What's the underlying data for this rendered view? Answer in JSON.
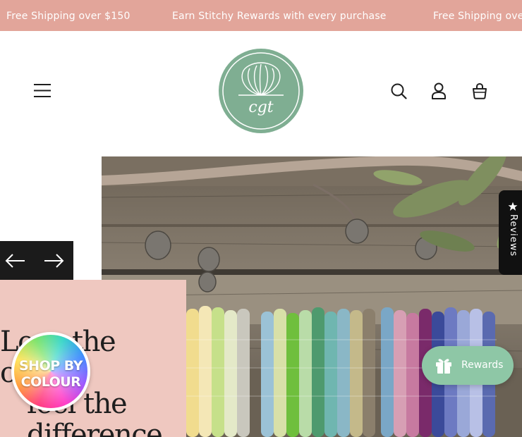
{
  "announcement": {
    "items": [
      "Free Shipping over $150",
      "Earn Stitchy Rewards with every purchase",
      "Free Shipping over $150"
    ]
  },
  "header": {
    "menu_icon": "hamburger-menu-icon",
    "logo_text": "cgt",
    "search_icon": "search-icon",
    "account_icon": "user-icon",
    "cart_icon": "shopping-bag-icon"
  },
  "hero": {
    "title_lines": [
      "Love the",
      "colour,",
      "feel the",
      "difference"
    ],
    "prev_icon": "arrow-left-icon",
    "next_icon": "arrow-right-icon"
  },
  "shop_badge": {
    "line1": "SHOP BY",
    "line2": "COLOUR"
  },
  "reviews_tab": {
    "label": "Reviews",
    "icon": "star-icon"
  },
  "rewards": {
    "label": "Rewards",
    "icon": "gift-icon"
  },
  "colors": {
    "announcement_bg": "#e2a59a",
    "logo_green": "#7fae92",
    "panel_pink": "#efc8c0",
    "rewards_green": "#8ec7a6"
  }
}
